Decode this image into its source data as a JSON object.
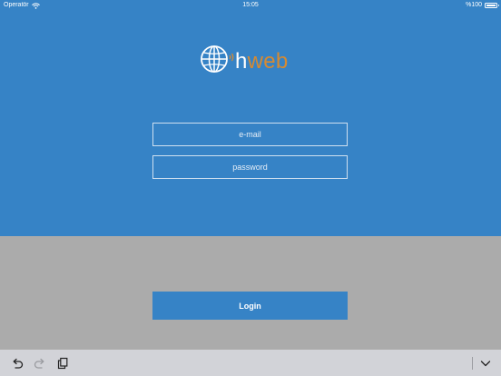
{
  "status_bar": {
    "carrier": "Operatör",
    "time": "15:05",
    "battery": "%100"
  },
  "logo": {
    "h": "h",
    "web": "web",
    "icon": "globe-icon"
  },
  "form": {
    "email_placeholder": "e-mail",
    "password_placeholder": "password",
    "login_label": "Login"
  },
  "toolbar": {
    "icons": [
      "undo-icon",
      "redo-icon",
      "paste-icon",
      "chevron-down-icon"
    ]
  },
  "colors": {
    "primary_blue": "#3683c6",
    "gray_background": "#ababab",
    "logo_orange": "#d58a33",
    "toolbar_background": "#d2d3d8"
  }
}
